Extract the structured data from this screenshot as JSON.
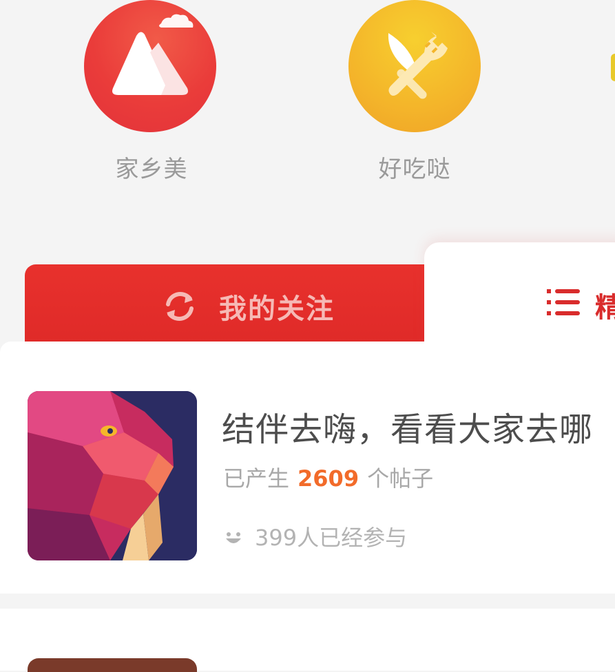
{
  "categories": [
    {
      "label": "家乡美",
      "icon": "mountain-icon",
      "color": "#e93d3a"
    },
    {
      "label": "好吃哒",
      "icon": "fork-knife-icon",
      "color": "#f4b52a"
    }
  ],
  "tabs": {
    "follow": {
      "label": "我的关注",
      "icon": "refresh-icon"
    },
    "featured": {
      "label": "精",
      "icon": "list-icon"
    }
  },
  "topic_card": {
    "title": "结伴去嗨，看看大家去哪",
    "stats_prefix": "已产生",
    "post_count": "2609",
    "stats_suffix": "个帖子",
    "participants": "399人已经参与",
    "icon": "smile-icon"
  },
  "colors": {
    "brand_red": "#e2302c",
    "accent_orange": "#f26b2a",
    "gray_text": "#9a9a9a"
  }
}
